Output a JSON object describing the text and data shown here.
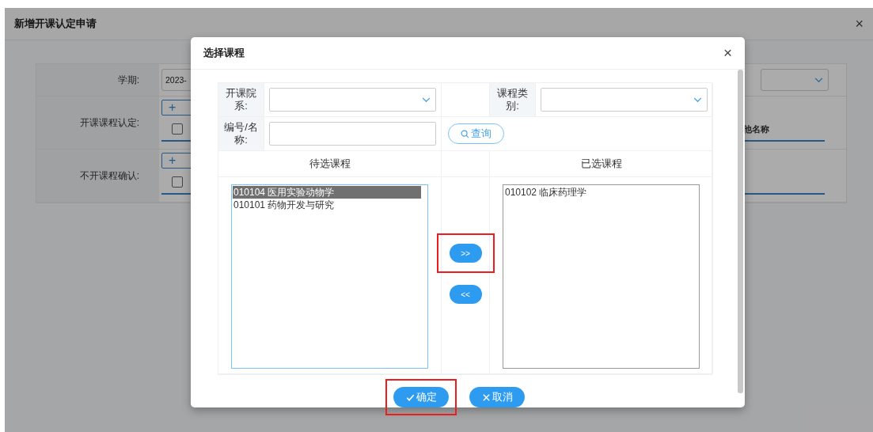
{
  "background_dialog": {
    "title": "新增开课认定申请",
    "close": "×",
    "form": {
      "rows": [
        {
          "kind": "select",
          "label": "学期:",
          "value": "2023-"
        },
        {
          "kind": "table",
          "label": "开课课程认定:",
          "add_button": "+",
          "header_checkbox": {
            "checked": false
          },
          "column_header": "他名称"
        },
        {
          "kind": "table",
          "label": "不开课程确认:",
          "add_button": "+",
          "header_checkbox": {
            "checked": false
          }
        }
      ]
    }
  },
  "modal": {
    "title": "选择课程",
    "close": "×",
    "filters": [
      {
        "kind": "select",
        "label": "开课院系:"
      },
      {
        "kind": "select",
        "label": "课程类别:"
      },
      {
        "kind": "text",
        "label": "编号/名称:"
      }
    ],
    "search_button": "查询",
    "available": {
      "heading": "待选课程",
      "items": [
        {
          "text": "010104 医用实验动物学",
          "selected": true
        },
        {
          "text": "010101 药物开发与研究",
          "selected": false
        }
      ]
    },
    "chosen": {
      "heading": "已选课程",
      "items": [
        {
          "text": "010102 临床药理学",
          "selected": false
        }
      ]
    },
    "move_buttons": [
      {
        "label": ">>",
        "highlighted": true
      },
      {
        "label": "<<",
        "highlighted": false
      }
    ],
    "footer_buttons": [
      {
        "kind": "confirm",
        "label": "确定",
        "highlighted": true
      },
      {
        "kind": "cancel",
        "label": "取消",
        "highlighted": false
      }
    ]
  }
}
